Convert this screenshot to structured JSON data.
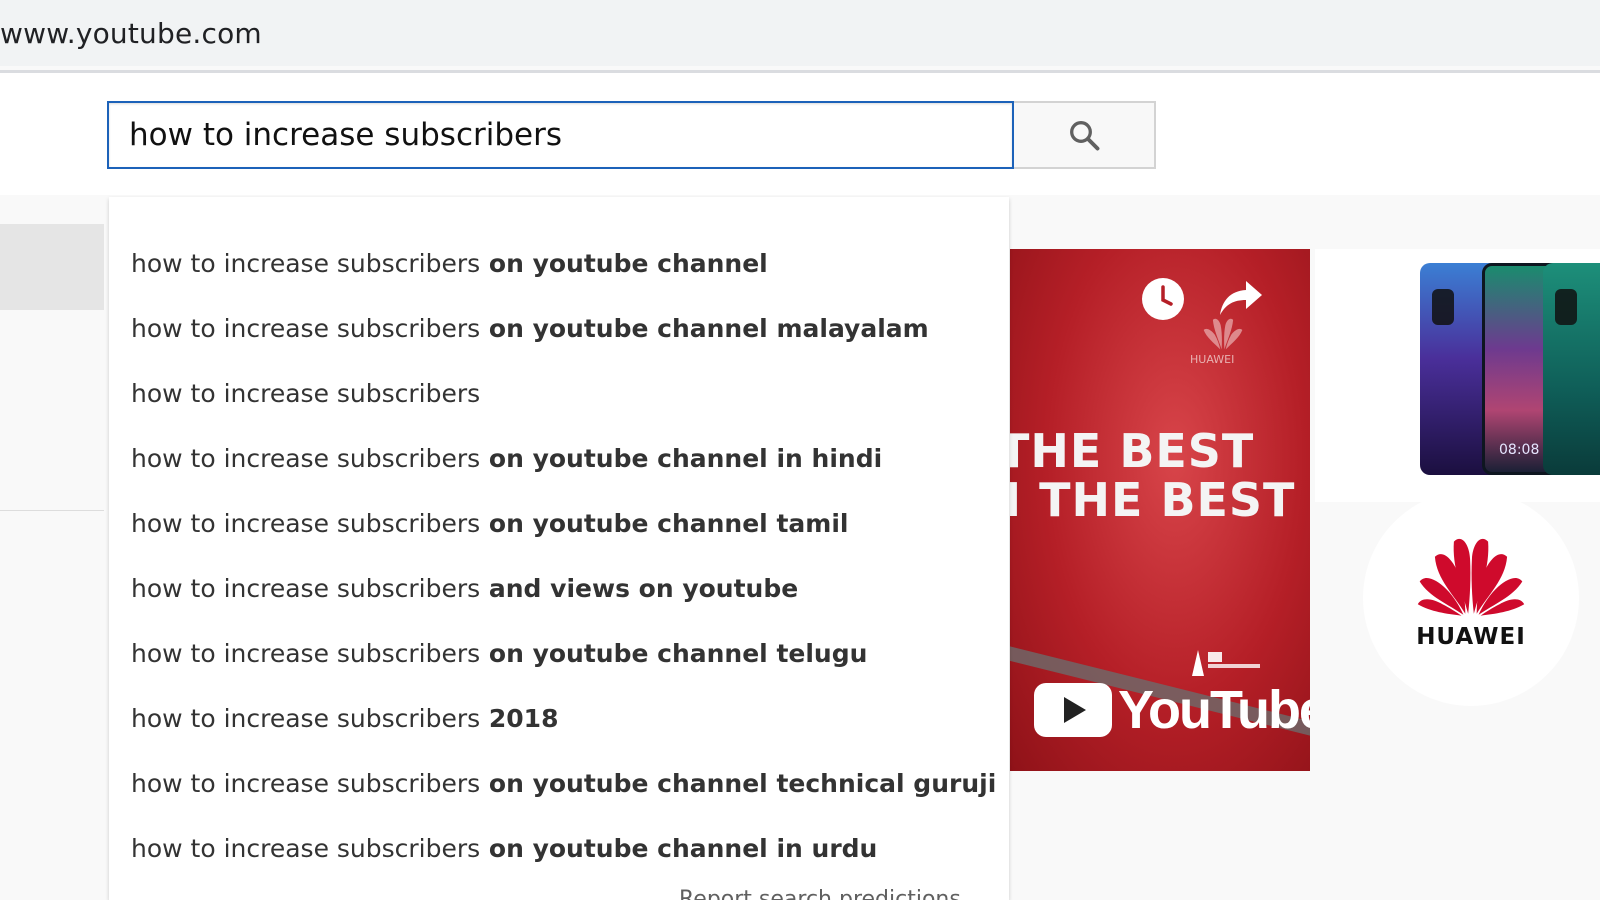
{
  "browser": {
    "url": "www.youtube.com"
  },
  "search": {
    "value": "how to increase subscribers",
    "button_icon": "search-icon"
  },
  "suggestions": [
    {
      "query": "how to increase subscribers",
      "completion": " on youtube channel"
    },
    {
      "query": "how to increase subscribers",
      "completion": " on youtube channel malayalam"
    },
    {
      "query": "how to increase subscribers",
      "completion": ""
    },
    {
      "query": "how to increase subscribers",
      "completion": " on youtube channel in hindi"
    },
    {
      "query": "how to increase subscribers",
      "completion": " on youtube channel tamil"
    },
    {
      "query": "how to increase subscribers",
      "completion": " and views on youtube"
    },
    {
      "query": "how to increase subscribers",
      "completion": " on youtube channel telugu"
    },
    {
      "query": "how to increase subscribers",
      "completion": " 2018"
    },
    {
      "query": "how to increase subscribers",
      "completion": " on youtube channel technical guruji"
    },
    {
      "query": "how to increase subscribers",
      "completion": " on youtube channel in urdu"
    }
  ],
  "suggest_footer": "Report search predictions",
  "ad": {
    "line1": "THE BEST",
    "line2": "I THE BEST",
    "brand_small": "HUAWEI",
    "youtube_word": "YouTube",
    "phone_time": "08:08"
  },
  "promo": {
    "brand": "HUAWEI"
  },
  "colors": {
    "search_border": "#1c62b9",
    "ad_red": "#b51f27",
    "huawei_red": "#cf0a2c"
  }
}
